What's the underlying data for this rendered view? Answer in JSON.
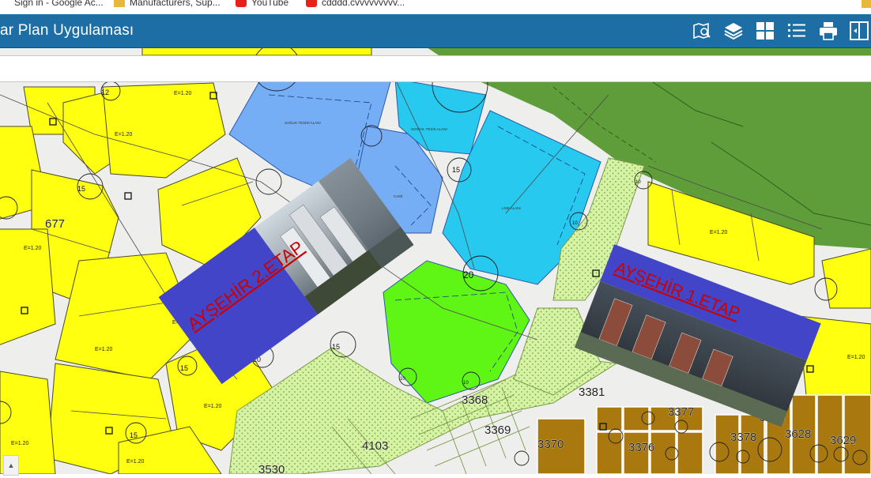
{
  "browser": {
    "bookmarks": [
      {
        "label": "Sign in - Google Ac...",
        "icon": "google-icon"
      },
      {
        "label": "Manufacturers, Sup...",
        "icon": "folder-icon"
      },
      {
        "label": "YouTube",
        "icon": "youtube-icon"
      },
      {
        "label": "cdddd.cvvvvvvvvv...",
        "icon": "youtube-icon"
      }
    ]
  },
  "app": {
    "title": "ar Plan Uygulaması",
    "toolbar": [
      "map-search-icon",
      "layers-icon",
      "grid-icon",
      "list-icon",
      "print-icon",
      "split-view-icon"
    ]
  },
  "map": {
    "labels": {
      "e1": "E=1.20",
      "saglik": "SAĞLIK TESİSİ ALANI",
      "sosyal": "SOSYAL TESİS ALANI",
      "cami": "CAMİ",
      "lise": "LİSE ALANI"
    },
    "parcels": [
      "677",
      "3368",
      "3369",
      "3381",
      "3377",
      "3376",
      "3370",
      "3378",
      "3663",
      "3628",
      "3629",
      "4103",
      "3530"
    ],
    "road_widths": [
      "12",
      "15",
      "15",
      "15",
      "20",
      "15",
      "15",
      "10",
      "10",
      "10",
      "10",
      "20"
    ],
    "banners": [
      {
        "text": "AYŞEHİR 2.ETAP"
      },
      {
        "text": "AYŞEHİR 1.ETAP"
      }
    ]
  }
}
